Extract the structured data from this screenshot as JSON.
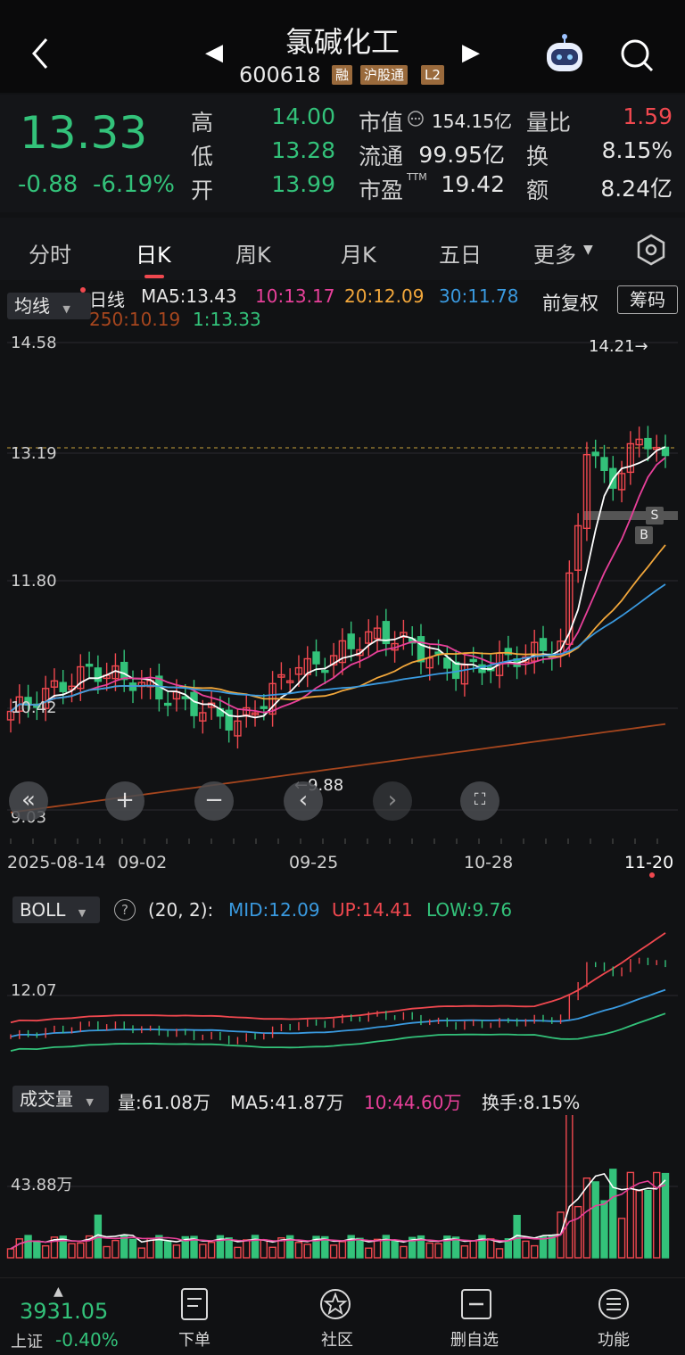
{
  "header": {
    "title": "氯碱化工",
    "code": "600618",
    "tags": [
      "融",
      "沪股通",
      "L2"
    ]
  },
  "quote": {
    "price": "13.33",
    "change": "-0.88",
    "change_pct": "-6.19%",
    "stats": [
      {
        "label": "高",
        "value": "14.00"
      },
      {
        "label": "低",
        "value": "13.28"
      },
      {
        "label": "开",
        "value": "13.99"
      },
      {
        "label": "市值",
        "value": "154.15亿"
      },
      {
        "label": "流通",
        "value": "99.95亿"
      },
      {
        "label": "市盈",
        "value": "19.42"
      },
      {
        "label": "量比",
        "value": "1.59"
      },
      {
        "label": "换",
        "value": "8.15%"
      },
      {
        "label": "额",
        "value": "8.24亿"
      }
    ],
    "ttm": "TTM"
  },
  "tabs": [
    "分时",
    "日K",
    "周K",
    "月K",
    "五日",
    "更多"
  ],
  "kline": {
    "indicator_select": "均线",
    "period": "日线",
    "ma5": "MA5:13.43",
    "ma10": "10:13.17",
    "ma20": "20:12.09",
    "ma30": "30:11.78",
    "ma250": "250:10.19",
    "ma1": "1:13.33",
    "adjust": "前复权",
    "chips": "筹码",
    "y_labels": [
      "14.58",
      "13.19",
      "11.80",
      "10.42",
      "9.03"
    ],
    "max_label": "14.21→",
    "min_label": "←9.88",
    "dates": [
      "2025-08-14",
      "09-02",
      "09-25",
      "10-28",
      "11-20"
    ],
    "markers": [
      "S",
      "B"
    ]
  },
  "boll": {
    "select": "BOLL",
    "params": "(20, 2):",
    "mid": "MID:12.09",
    "up": "UP:14.41",
    "low": "LOW:9.76",
    "y_label": "12.07"
  },
  "volume": {
    "select": "成交量",
    "vol": "量:61.08万",
    "ma5": "MA5:41.87万",
    "ma10": "10:44.60万",
    "turnover": "换手:8.15%",
    "y_label": "43.88万"
  },
  "footer": {
    "index_value": "3931.05",
    "index_name": "上证",
    "index_pct": "-0.40%",
    "items": [
      "下单",
      "社区",
      "删自选",
      "功能"
    ]
  },
  "colors": {
    "up": "#f0484f",
    "down": "#33c27a",
    "ma5": "#ffffff",
    "ma10": "#e8409a",
    "ma20": "#f2a73b",
    "ma30": "#3a9ae0",
    "ma250": "#a6461e",
    "boll_mid": "#3a9ae0",
    "boll_up": "#f0484f",
    "boll_low": "#33c27a"
  }
}
